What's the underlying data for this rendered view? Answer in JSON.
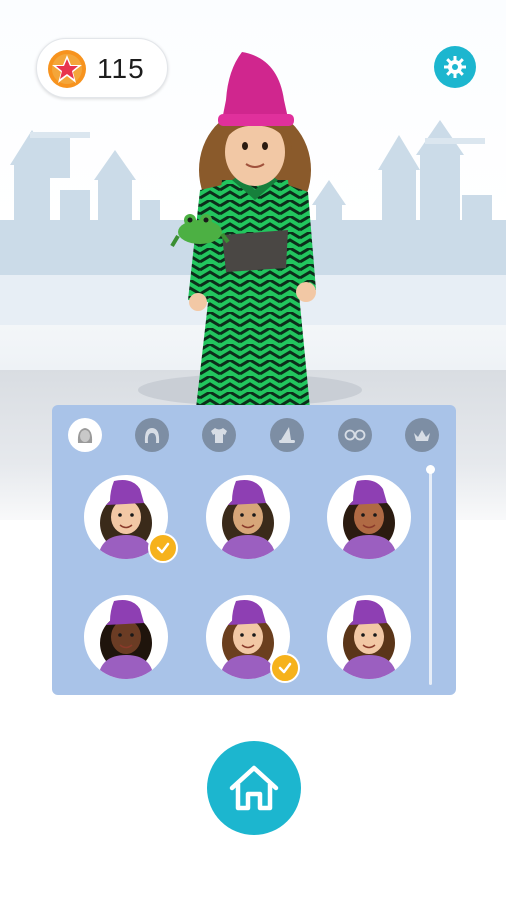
{
  "header": {
    "coins": "115",
    "coin_icon": "star-coin-icon",
    "settings_icon": "gear-icon"
  },
  "colors": {
    "accent": "#1cb6cf",
    "panel": "#a9c3e8",
    "check": "#f6b21c",
    "tab_inactive": "#7d8ea4"
  },
  "avatar_panel": {
    "tabs": [
      {
        "name": "face",
        "icon": "face-icon",
        "active": true
      },
      {
        "name": "hair",
        "icon": "hair-icon",
        "active": false
      },
      {
        "name": "clothing",
        "icon": "shirt-icon",
        "active": false
      },
      {
        "name": "hat",
        "icon": "wizard-hat-icon",
        "active": false
      },
      {
        "name": "glasses",
        "icon": "glasses-icon",
        "active": false
      },
      {
        "name": "accessory",
        "icon": "crown-icon",
        "active": false
      }
    ],
    "options": [
      {
        "skin": "#f2c8a5",
        "hair": "#3a2a1a",
        "selected": true
      },
      {
        "skin": "#d7a679",
        "hair": "#3a2a1a",
        "selected": false
      },
      {
        "skin": "#b06a44",
        "hair": "#2b1b10",
        "selected": false
      },
      {
        "skin": "#6b3c24",
        "hair": "#1f140c",
        "selected": false
      },
      {
        "skin": "#f2c8a5",
        "hair": "#6b3f1e",
        "selected": true
      },
      {
        "skin": "#f2c8a5",
        "hair": "#5a3518",
        "selected": false
      }
    ]
  },
  "footer": {
    "home_icon": "home-icon"
  }
}
